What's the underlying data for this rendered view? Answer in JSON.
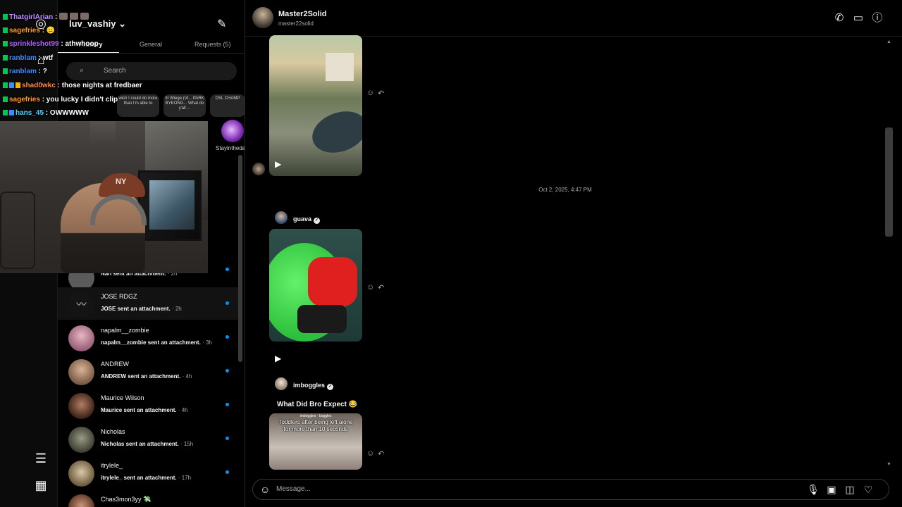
{
  "inbox": {
    "username": "luv_vashiy",
    "tabs": [
      "Primary",
      "General",
      "Requests (5)"
    ],
    "search_placeholder": "Search",
    "notes": [
      "wish I could do more than I'm able to",
      "III Wiege (Vl... PARK BYEONG... What do y'all ...",
      "DSL CHAMP"
    ],
    "note_user": "Stayintheda",
    "threads": [
      {
        "name": "",
        "preview": "Nan sent an attachment.",
        "time": "· 2h"
      },
      {
        "name": "JOSE RDGZ",
        "preview": "JOSE sent an attachment.",
        "time": "· 2h"
      },
      {
        "name": "napalm__zombie",
        "preview": "napalm__zombie sent an attachment.",
        "time": "· 3h"
      },
      {
        "name": "ANDREW",
        "preview": "ANDREW sent an attachment.",
        "time": "· 4h"
      },
      {
        "name": "Maurice Wilson",
        "preview": "Maurice sent an attachment.",
        "time": "· 4h"
      },
      {
        "name": "Nicholas",
        "preview": "Nicholas sent an attachment.",
        "time": "· 15h"
      },
      {
        "name": "itrylele_",
        "preview": "itrylele_ sent an attachment.",
        "time": "· 17h"
      },
      {
        "name": "Chas3mon3yy 💸",
        "preview": "",
        "time": ""
      }
    ]
  },
  "chat": [
    {
      "user": "ThatgirlArian",
      "sep": " :",
      "msg": "",
      "color": "#c08cff"
    },
    {
      "user": "sagefries",
      "sep": " :",
      "msg": " 😐",
      "color": "#ff9a2b"
    },
    {
      "user": "sprinkleshot99",
      "sep": " :",
      "msg": " athwhoop",
      "color": "#b05cff"
    },
    {
      "user": "ranblam",
      "sep": " :",
      "msg": " wtf",
      "color": "#3d8bff"
    },
    {
      "user": "ranblam",
      "sep": " :",
      "msg": " ?",
      "color": "#3d8bff"
    },
    {
      "user": "shad0wkc",
      "sep": " :",
      "msg": " those nights at fredbaer",
      "color": "#ff8a3d"
    },
    {
      "user": "sagefries",
      "sep": " :",
      "msg": " you lucky I didn't clip",
      "color": "#ff9a2b"
    },
    {
      "user": "hans_45",
      "sep": " :",
      "msg": " OWWWWW",
      "color": "#4fd4ff"
    }
  ],
  "conversation": {
    "title": "Master2Solid",
    "subtitle": "master22solid",
    "timestamp": "Oct 2, 2025, 4:47 PM",
    "share1_user": "guava",
    "share2_user": "imboggles",
    "share2_caption": "What Did Bro Expect 😂",
    "video3_caption": "Toddlers after being left alone for more than 10 seconds",
    "video3_top": "imboggles · boggles",
    "composer_placeholder": "Message..."
  },
  "icons": {
    "call": "phone-icon",
    "video": "video-call-icon",
    "info": "info-icon",
    "compose": "compose-icon",
    "emoji": "emoji-icon",
    "mic": "microphone-icon",
    "image": "image-icon",
    "sticker": "sticker-icon",
    "like": "heart-icon"
  },
  "colors": {
    "unread_dot": "#0095f6",
    "background": "#000000"
  }
}
